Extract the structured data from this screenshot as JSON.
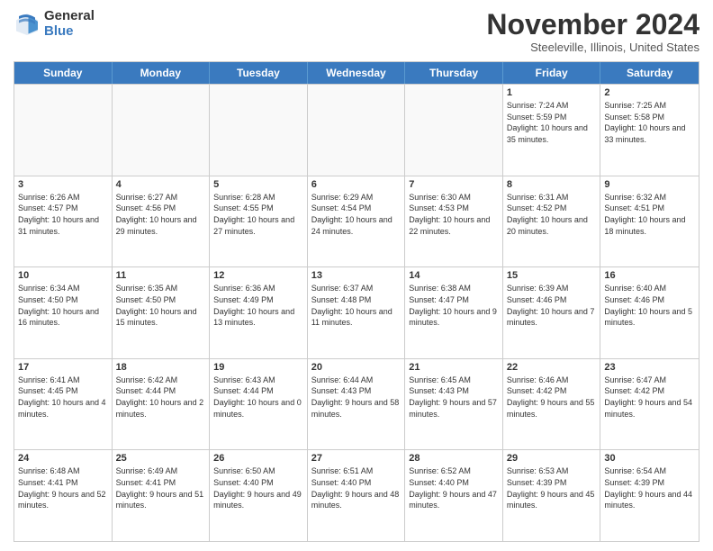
{
  "logo": {
    "general": "General",
    "blue": "Blue"
  },
  "header": {
    "month": "November 2024",
    "location": "Steeleville, Illinois, United States"
  },
  "weekdays": [
    "Sunday",
    "Monday",
    "Tuesday",
    "Wednesday",
    "Thursday",
    "Friday",
    "Saturday"
  ],
  "rows": [
    [
      {
        "day": "",
        "empty": true
      },
      {
        "day": "",
        "empty": true
      },
      {
        "day": "",
        "empty": true
      },
      {
        "day": "",
        "empty": true
      },
      {
        "day": "",
        "empty": true
      },
      {
        "day": "1",
        "sunrise": "Sunrise: 7:24 AM",
        "sunset": "Sunset: 5:59 PM",
        "daylight": "Daylight: 10 hours and 35 minutes."
      },
      {
        "day": "2",
        "sunrise": "Sunrise: 7:25 AM",
        "sunset": "Sunset: 5:58 PM",
        "daylight": "Daylight: 10 hours and 33 minutes."
      }
    ],
    [
      {
        "day": "3",
        "sunrise": "Sunrise: 6:26 AM",
        "sunset": "Sunset: 4:57 PM",
        "daylight": "Daylight: 10 hours and 31 minutes."
      },
      {
        "day": "4",
        "sunrise": "Sunrise: 6:27 AM",
        "sunset": "Sunset: 4:56 PM",
        "daylight": "Daylight: 10 hours and 29 minutes."
      },
      {
        "day": "5",
        "sunrise": "Sunrise: 6:28 AM",
        "sunset": "Sunset: 4:55 PM",
        "daylight": "Daylight: 10 hours and 27 minutes."
      },
      {
        "day": "6",
        "sunrise": "Sunrise: 6:29 AM",
        "sunset": "Sunset: 4:54 PM",
        "daylight": "Daylight: 10 hours and 24 minutes."
      },
      {
        "day": "7",
        "sunrise": "Sunrise: 6:30 AM",
        "sunset": "Sunset: 4:53 PM",
        "daylight": "Daylight: 10 hours and 22 minutes."
      },
      {
        "day": "8",
        "sunrise": "Sunrise: 6:31 AM",
        "sunset": "Sunset: 4:52 PM",
        "daylight": "Daylight: 10 hours and 20 minutes."
      },
      {
        "day": "9",
        "sunrise": "Sunrise: 6:32 AM",
        "sunset": "Sunset: 4:51 PM",
        "daylight": "Daylight: 10 hours and 18 minutes."
      }
    ],
    [
      {
        "day": "10",
        "sunrise": "Sunrise: 6:34 AM",
        "sunset": "Sunset: 4:50 PM",
        "daylight": "Daylight: 10 hours and 16 minutes."
      },
      {
        "day": "11",
        "sunrise": "Sunrise: 6:35 AM",
        "sunset": "Sunset: 4:50 PM",
        "daylight": "Daylight: 10 hours and 15 minutes."
      },
      {
        "day": "12",
        "sunrise": "Sunrise: 6:36 AM",
        "sunset": "Sunset: 4:49 PM",
        "daylight": "Daylight: 10 hours and 13 minutes."
      },
      {
        "day": "13",
        "sunrise": "Sunrise: 6:37 AM",
        "sunset": "Sunset: 4:48 PM",
        "daylight": "Daylight: 10 hours and 11 minutes."
      },
      {
        "day": "14",
        "sunrise": "Sunrise: 6:38 AM",
        "sunset": "Sunset: 4:47 PM",
        "daylight": "Daylight: 10 hours and 9 minutes."
      },
      {
        "day": "15",
        "sunrise": "Sunrise: 6:39 AM",
        "sunset": "Sunset: 4:46 PM",
        "daylight": "Daylight: 10 hours and 7 minutes."
      },
      {
        "day": "16",
        "sunrise": "Sunrise: 6:40 AM",
        "sunset": "Sunset: 4:46 PM",
        "daylight": "Daylight: 10 hours and 5 minutes."
      }
    ],
    [
      {
        "day": "17",
        "sunrise": "Sunrise: 6:41 AM",
        "sunset": "Sunset: 4:45 PM",
        "daylight": "Daylight: 10 hours and 4 minutes."
      },
      {
        "day": "18",
        "sunrise": "Sunrise: 6:42 AM",
        "sunset": "Sunset: 4:44 PM",
        "daylight": "Daylight: 10 hours and 2 minutes."
      },
      {
        "day": "19",
        "sunrise": "Sunrise: 6:43 AM",
        "sunset": "Sunset: 4:44 PM",
        "daylight": "Daylight: 10 hours and 0 minutes."
      },
      {
        "day": "20",
        "sunrise": "Sunrise: 6:44 AM",
        "sunset": "Sunset: 4:43 PM",
        "daylight": "Daylight: 9 hours and 58 minutes."
      },
      {
        "day": "21",
        "sunrise": "Sunrise: 6:45 AM",
        "sunset": "Sunset: 4:43 PM",
        "daylight": "Daylight: 9 hours and 57 minutes."
      },
      {
        "day": "22",
        "sunrise": "Sunrise: 6:46 AM",
        "sunset": "Sunset: 4:42 PM",
        "daylight": "Daylight: 9 hours and 55 minutes."
      },
      {
        "day": "23",
        "sunrise": "Sunrise: 6:47 AM",
        "sunset": "Sunset: 4:42 PM",
        "daylight": "Daylight: 9 hours and 54 minutes."
      }
    ],
    [
      {
        "day": "24",
        "sunrise": "Sunrise: 6:48 AM",
        "sunset": "Sunset: 4:41 PM",
        "daylight": "Daylight: 9 hours and 52 minutes."
      },
      {
        "day": "25",
        "sunrise": "Sunrise: 6:49 AM",
        "sunset": "Sunset: 4:41 PM",
        "daylight": "Daylight: 9 hours and 51 minutes."
      },
      {
        "day": "26",
        "sunrise": "Sunrise: 6:50 AM",
        "sunset": "Sunset: 4:40 PM",
        "daylight": "Daylight: 9 hours and 49 minutes."
      },
      {
        "day": "27",
        "sunrise": "Sunrise: 6:51 AM",
        "sunset": "Sunset: 4:40 PM",
        "daylight": "Daylight: 9 hours and 48 minutes."
      },
      {
        "day": "28",
        "sunrise": "Sunrise: 6:52 AM",
        "sunset": "Sunset: 4:40 PM",
        "daylight": "Daylight: 9 hours and 47 minutes."
      },
      {
        "day": "29",
        "sunrise": "Sunrise: 6:53 AM",
        "sunset": "Sunset: 4:39 PM",
        "daylight": "Daylight: 9 hours and 45 minutes."
      },
      {
        "day": "30",
        "sunrise": "Sunrise: 6:54 AM",
        "sunset": "Sunset: 4:39 PM",
        "daylight": "Daylight: 9 hours and 44 minutes."
      }
    ]
  ]
}
